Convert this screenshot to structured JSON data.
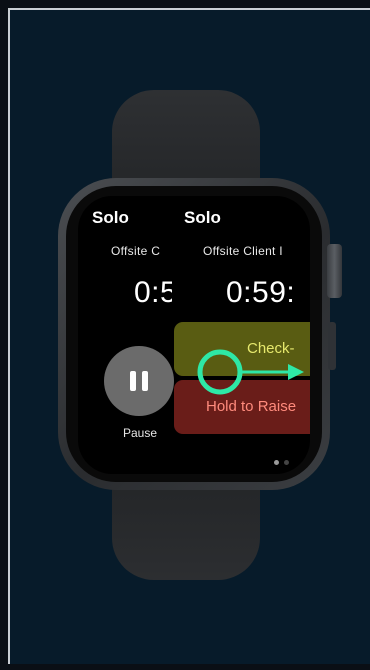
{
  "app": {
    "screens": [
      {
        "title": "Solo",
        "subtitle": "Offsite C",
        "timer": "0:5"
      },
      {
        "title": "Solo",
        "subtitle": "Offsite Client I",
        "timer": "0:59:",
        "actions": {
          "checkin_label": "Check-",
          "raise_label": "Hold to Raise"
        }
      }
    ],
    "pause": {
      "label": "Pause",
      "icon": "pause-icon"
    }
  },
  "gesture": {
    "icon": "swipe-right-icon",
    "direction": "right",
    "color": "#2ee8a6"
  },
  "colors": {
    "checkin_bg": "#595c12",
    "checkin_text": "#e6e86d",
    "raise_bg": "#6a1d19",
    "raise_text": "#ff8a7c"
  }
}
